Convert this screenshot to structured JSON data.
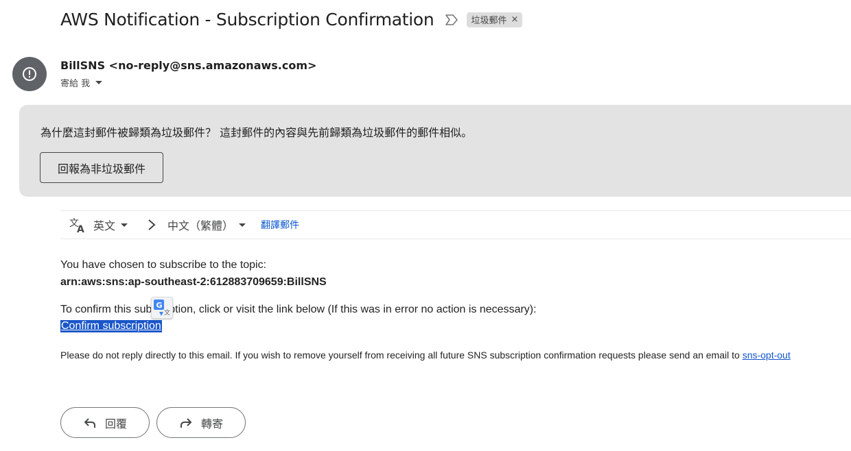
{
  "email": {
    "subject": "AWS Notification - Subscription Confirmation",
    "label": "垃圾郵件",
    "label_remove": "×",
    "sender_name": "BillSNS",
    "sender_email": "<no-reply@sns.amazonaws.com>",
    "recipient_line": "寄給 我"
  },
  "spam_notice": {
    "message": "為什麼這封郵件被歸類為垃圾郵件？ 這封郵件的內容與先前歸類為垃圾郵件的郵件相似。",
    "report_button": "回報為非垃圾郵件"
  },
  "translate_bar": {
    "source_lang": "英文",
    "target_lang": "中文（繁體）",
    "translate_link": "翻譯郵件"
  },
  "body": {
    "line1": "You have chosen to subscribe to the topic:",
    "arn": "arn:aws:sns:ap-southeast-2:612883709659:BillSNS",
    "line2": "To confirm this subscription, click or visit the link below (If this was in error no action is necessary):",
    "confirm_link": "Confirm subscription",
    "footer": "Please do not reply directly to this email. If you wish to remove yourself from receiving all future SNS subscription confirmation requests please send an email to",
    "opt_out_link": "sns-opt-out"
  },
  "actions": {
    "reply": "回覆",
    "forward": "轉寄"
  },
  "icons": {
    "avatar": "alert-circle-icon",
    "importance": "importance-marker-icon",
    "translate": "translate-icon",
    "google_translate": "google-translate-icon",
    "reply": "reply-arrow-icon",
    "forward": "forward-arrow-icon"
  },
  "colors": {
    "avatar_bg": "#5f6368",
    "spam_bg": "#e3e3e3",
    "link_blue": "#0b57d0",
    "selection_blue": "#1a56c9"
  }
}
